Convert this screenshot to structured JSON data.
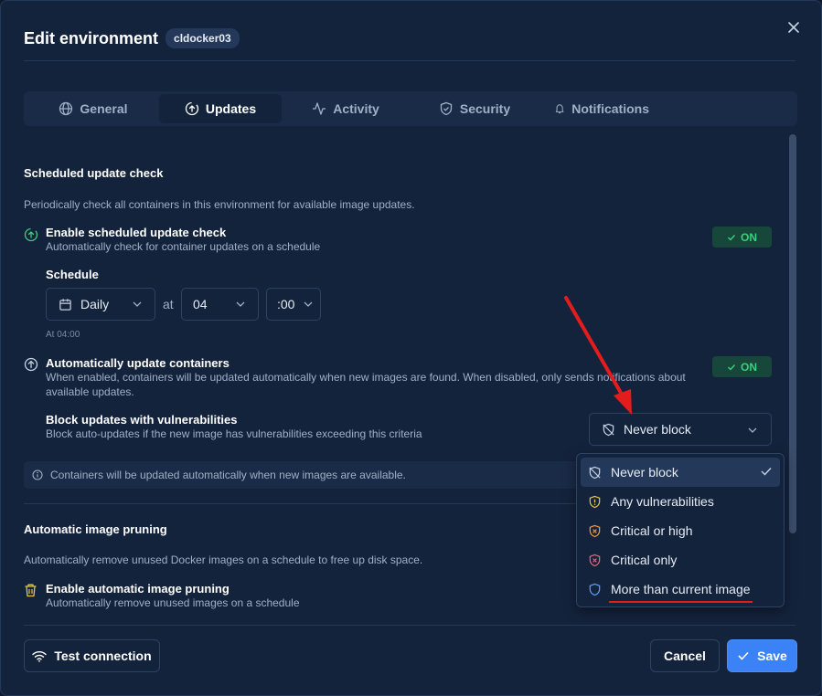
{
  "header": {
    "title": "Edit environment",
    "env_name": "cldocker03"
  },
  "tabs": [
    {
      "label": "General",
      "icon": "globe-icon"
    },
    {
      "label": "Updates",
      "icon": "update-icon"
    },
    {
      "label": "Activity",
      "icon": "activity-icon"
    },
    {
      "label": "Security",
      "icon": "shield-icon"
    },
    {
      "label": "Notifications",
      "icon": "bell-icon"
    }
  ],
  "active_tab": "Updates",
  "scheduled": {
    "section_title": "Scheduled update check",
    "section_desc": "Periodically check all containers in this environment for available image updates.",
    "enable_title": "Enable scheduled update check",
    "enable_sub": "Automatically check for container updates on a schedule",
    "enable_state": "ON",
    "schedule_label": "Schedule",
    "frequency": "Daily",
    "at_label": "at",
    "hour": "04",
    "minute": ":00",
    "schedule_note": "At 04:00"
  },
  "auto_update": {
    "title": "Automatically update containers",
    "sub": "When enabled, containers will be updated automatically when new images are found. When disabled, only sends notifications about available updates.",
    "state": "ON",
    "block_title": "Block updates with vulnerabilities",
    "block_sub": "Block auto-updates if the new image has vulnerabilities exceeding this criteria",
    "block_value": "Never block",
    "info": "Containers will be updated automatically when new images are available."
  },
  "dropdown": {
    "options": [
      {
        "label": "Never block",
        "icon": "shield-off-icon",
        "selected": true
      },
      {
        "label": "Any vulnerabilities",
        "icon": "shield-alert-icon",
        "selected": false
      },
      {
        "label": "Critical or high",
        "icon": "shield-x-icon",
        "selected": false
      },
      {
        "label": "Critical only",
        "icon": "shield-x-icon",
        "selected": false
      },
      {
        "label": "More than current image",
        "icon": "shield-icon",
        "selected": false
      }
    ]
  },
  "pruning": {
    "section_title": "Automatic image pruning",
    "section_desc": "Automatically remove unused Docker images on a schedule to free up disk space.",
    "enable_title": "Enable automatic image pruning",
    "enable_sub": "Automatically remove unused images on a schedule"
  },
  "footer": {
    "test_label": "Test connection",
    "cancel_label": "Cancel",
    "save_label": "Save"
  },
  "colors": {
    "accent": "#3b82f6",
    "on_green": "#3bd07a",
    "annotation_red": "#e41c1c"
  }
}
